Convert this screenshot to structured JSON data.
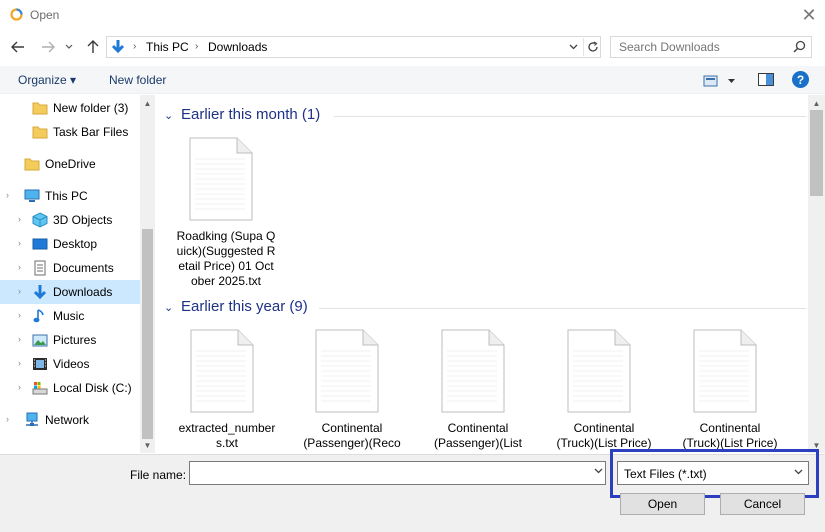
{
  "window": {
    "title": "Open",
    "close_symbol": "✕"
  },
  "address_bar": {
    "breadcrumbs": [
      "This PC",
      "Downloads"
    ],
    "separator": "›"
  },
  "search": {
    "placeholder": "Search Downloads"
  },
  "toolbar": {
    "organize_label": "Organize ▾",
    "new_folder_label": "New folder",
    "help_label": "?"
  },
  "nav": {
    "items": [
      {
        "label": "New folder (3)",
        "icon": "folder-icon"
      },
      {
        "label": "Task Bar Files",
        "icon": "folder-icon"
      },
      {
        "label": "OneDrive",
        "icon": "onedrive-folder-icon"
      },
      {
        "label": "This PC",
        "icon": "pc-icon"
      },
      {
        "label": "3D Objects",
        "icon": "3d-objects-icon"
      },
      {
        "label": "Desktop",
        "icon": "desktop-icon"
      },
      {
        "label": "Documents",
        "icon": "documents-icon"
      },
      {
        "label": "Downloads",
        "icon": "downloads-icon",
        "selected": true
      },
      {
        "label": "Music",
        "icon": "music-icon"
      },
      {
        "label": "Pictures",
        "icon": "pictures-icon"
      },
      {
        "label": "Videos",
        "icon": "videos-icon"
      },
      {
        "label": "Local Disk (C:)",
        "icon": "local-disk-icon"
      },
      {
        "label": "Network",
        "icon": "network-icon"
      }
    ]
  },
  "groups": [
    {
      "title": "Earlier this month (1)",
      "files": [
        {
          "name": "Roadking (Supa Quick)(Suggested Retail Price) 01 October 2025.txt"
        }
      ]
    },
    {
      "title": "Earlier this year (9)",
      "files": [
        {
          "name": "extracted_numbers.txt"
        },
        {
          "name": "Continental (Passenger)(Reco"
        },
        {
          "name": "Continental (Passenger)(List"
        },
        {
          "name": "Continental (Truck)(List Price)"
        },
        {
          "name": "Continental (Truck)(List Price)"
        }
      ]
    }
  ],
  "footer": {
    "filename_label": "File name:",
    "filename_value": "",
    "filetype_value": "Text Files (*.txt)",
    "open_label": "Open",
    "cancel_label": "Cancel"
  },
  "colors": {
    "accent": "#1e3287",
    "selection": "#cce8ff",
    "highlight_border": "#2b3fbf"
  }
}
